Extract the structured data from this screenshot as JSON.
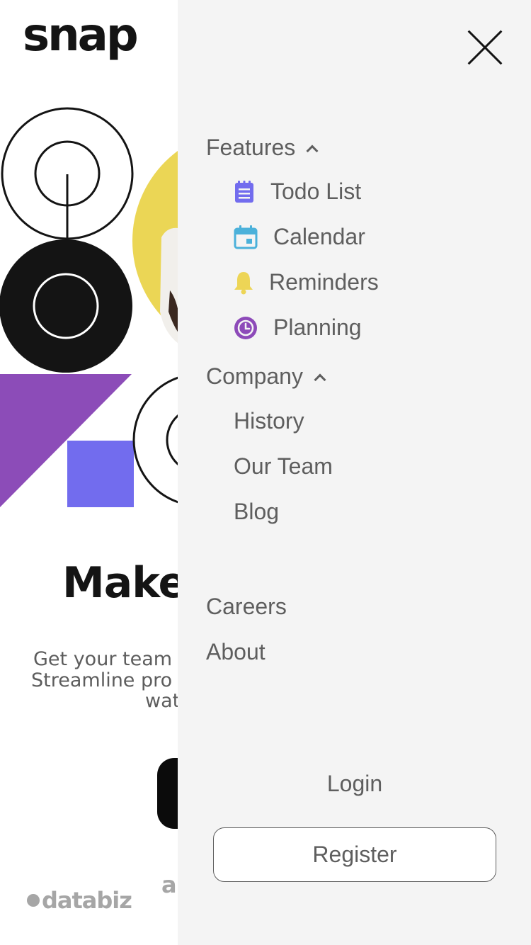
{
  "brand": {
    "logo_text": "snap"
  },
  "hero": {
    "title": "Make",
    "text_line1": "Get your team",
    "text_line2": "Streamline pro",
    "text_line3": "wat"
  },
  "partners": {
    "first": "databiz",
    "second": "a"
  },
  "colors": {
    "drawer_bg": "#f4f4f4",
    "text": "#5e5e5e",
    "todo_icon": "#726cee",
    "calendar_icon": "#4bb1da",
    "reminders_icon": "#edd556",
    "planning_icon": "#8d4ab9",
    "hero_purple": "#8c4cb8",
    "hero_blue": "#726cee",
    "hero_yellow": "#ebd655"
  },
  "drawer": {
    "close_icon": "close-icon",
    "features": {
      "label": "Features",
      "items": [
        {
          "label": "Todo List",
          "icon": "todo-list-icon"
        },
        {
          "label": "Calendar",
          "icon": "calendar-icon"
        },
        {
          "label": "Reminders",
          "icon": "bell-icon"
        },
        {
          "label": "Planning",
          "icon": "clock-icon"
        }
      ]
    },
    "company": {
      "label": "Company",
      "items": [
        {
          "label": "History"
        },
        {
          "label": "Our Team"
        },
        {
          "label": "Blog"
        }
      ]
    },
    "careers": "Careers",
    "about": "About",
    "login": "Login",
    "register": "Register"
  }
}
